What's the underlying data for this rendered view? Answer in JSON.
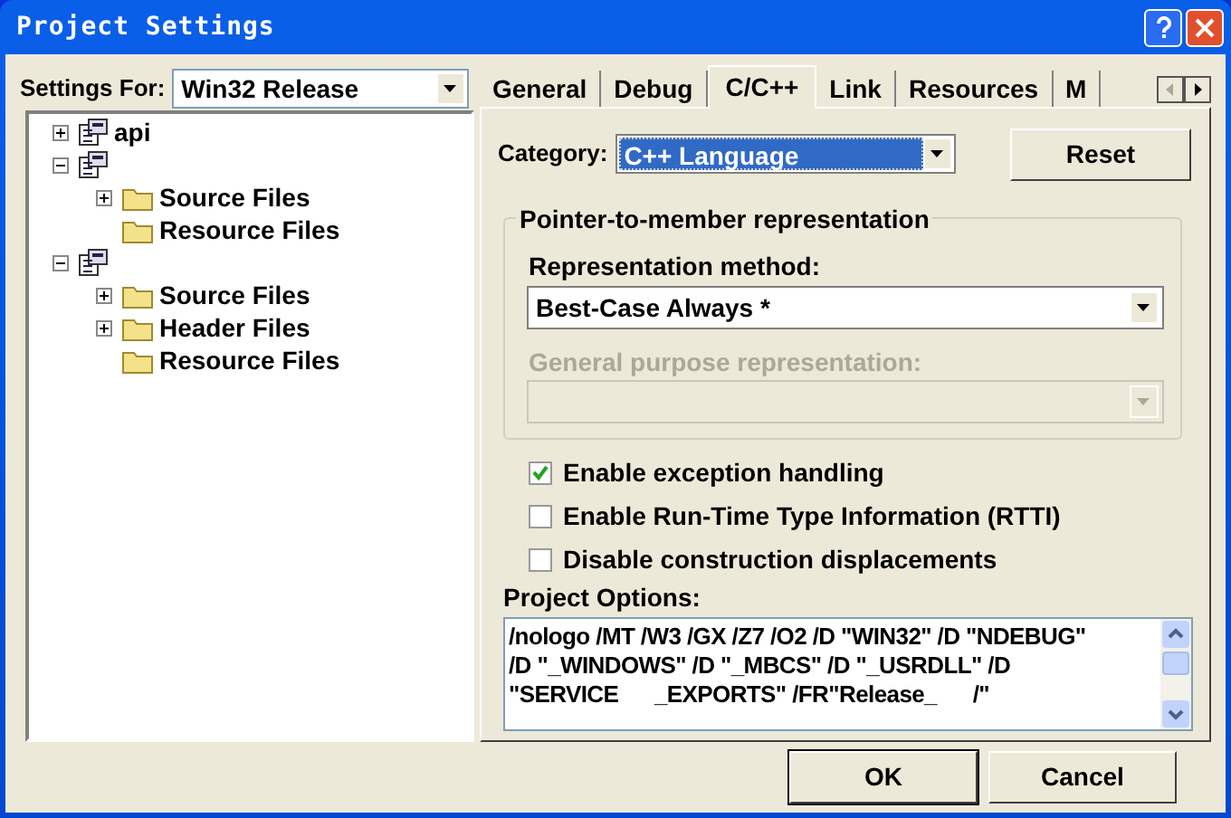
{
  "window": {
    "title": "Project Settings"
  },
  "settings_for": {
    "label": "Settings For:",
    "value": "Win32 Release"
  },
  "tree": [
    {
      "kind": "project",
      "name": "api",
      "expanded": false
    },
    {
      "kind": "project",
      "expanded": true,
      "children": [
        {
          "kind": "folder",
          "name": "Source Files",
          "expanded": false
        },
        {
          "kind": "folder",
          "name": "Resource Files"
        }
      ]
    },
    {
      "kind": "project",
      "expanded": true,
      "children": [
        {
          "kind": "folder",
          "name": "Source Files",
          "expanded": false
        },
        {
          "kind": "folder",
          "name": "Header Files",
          "expanded": false
        },
        {
          "kind": "folder",
          "name": "Resource Files"
        }
      ]
    }
  ],
  "tabs": [
    {
      "label": "General",
      "selected": false
    },
    {
      "label": "Debug",
      "selected": false
    },
    {
      "label": "C/C++",
      "selected": true
    },
    {
      "label": "Link",
      "selected": false
    },
    {
      "label": "Resources",
      "selected": false
    },
    {
      "label": "M",
      "selected": false
    }
  ],
  "category": {
    "label": "Category:",
    "value": "C++ Language"
  },
  "reset_button": {
    "label": "Reset"
  },
  "group": {
    "title": "Pointer-to-member representation",
    "method": {
      "label": "Representation method:",
      "value": "Best-Case Always *"
    },
    "general_purpose": {
      "label": "General purpose representation:",
      "disabled": true
    }
  },
  "checkboxes": [
    {
      "label": "Enable exception handling",
      "checked": true
    },
    {
      "label": "Enable Run-Time Type Information (RTTI)",
      "checked": false
    },
    {
      "label": "Disable construction displacements",
      "checked": false
    }
  ],
  "project_options": {
    "label": "Project Options:",
    "lines": [
      "/nologo /MT /W3 /GX /Z7 /O2 /D \"WIN32\" /D \"NDEBUG\"",
      "/D \"_WINDOWS\" /D \"_MBCS\" /D \"_USRDLL\" /D",
      "\"SERVICE      _EXPORTS\" /FR\"Release_      /\""
    ]
  },
  "buttons": [
    {
      "label": "OK",
      "default": true
    },
    {
      "label": "Cancel",
      "default": false
    }
  ]
}
